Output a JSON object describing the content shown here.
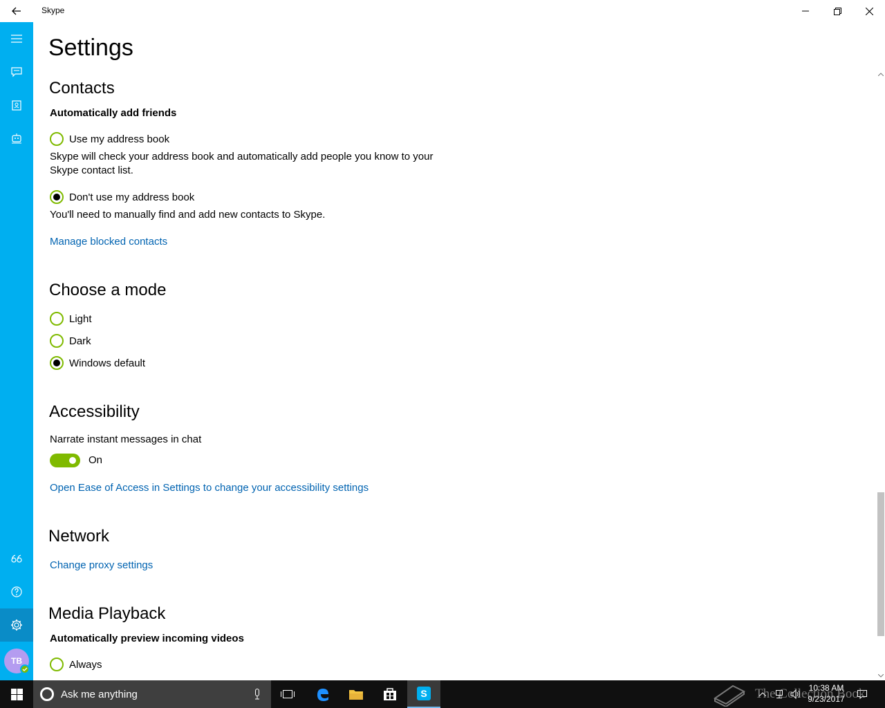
{
  "window": {
    "title": "Skype"
  },
  "page": {
    "title": "Settings"
  },
  "contacts": {
    "heading": "Contacts",
    "auto_add_label": "Automatically add friends",
    "option_use": "Use my address book",
    "option_use_desc": "Skype will check your address book and automatically add people you know to your Skype contact list.",
    "option_dont": "Don't use my address book",
    "option_dont_desc": "You'll need to manually find and add new contacts to Skype.",
    "selected": "Don't use my address book",
    "manage_link": "Manage blocked contacts"
  },
  "mode": {
    "heading": "Choose a mode",
    "options": [
      "Light",
      "Dark",
      "Windows default"
    ],
    "selected": "Windows default"
  },
  "accessibility": {
    "heading": "Accessibility",
    "narrate_label": "Narrate instant messages in chat",
    "toggle_state": "On",
    "ease_link": "Open Ease of Access in Settings to change your accessibility settings"
  },
  "network": {
    "heading": "Network",
    "proxy_link": "Change proxy settings"
  },
  "media": {
    "heading": "Media Playback",
    "preview_label": "Automatically preview incoming videos",
    "option_always": "Always"
  },
  "profile": {
    "initials": "TB",
    "presence_color": "#7fba00"
  },
  "taskbar": {
    "search_placeholder": "Ask me anything",
    "time": "10:38 AM",
    "date": "9/23/2017"
  },
  "watermark": {
    "text": "The Collection Book"
  },
  "colors": {
    "accent": "#00aff0",
    "radio_border": "#7fba00",
    "link": "#0063b1"
  }
}
